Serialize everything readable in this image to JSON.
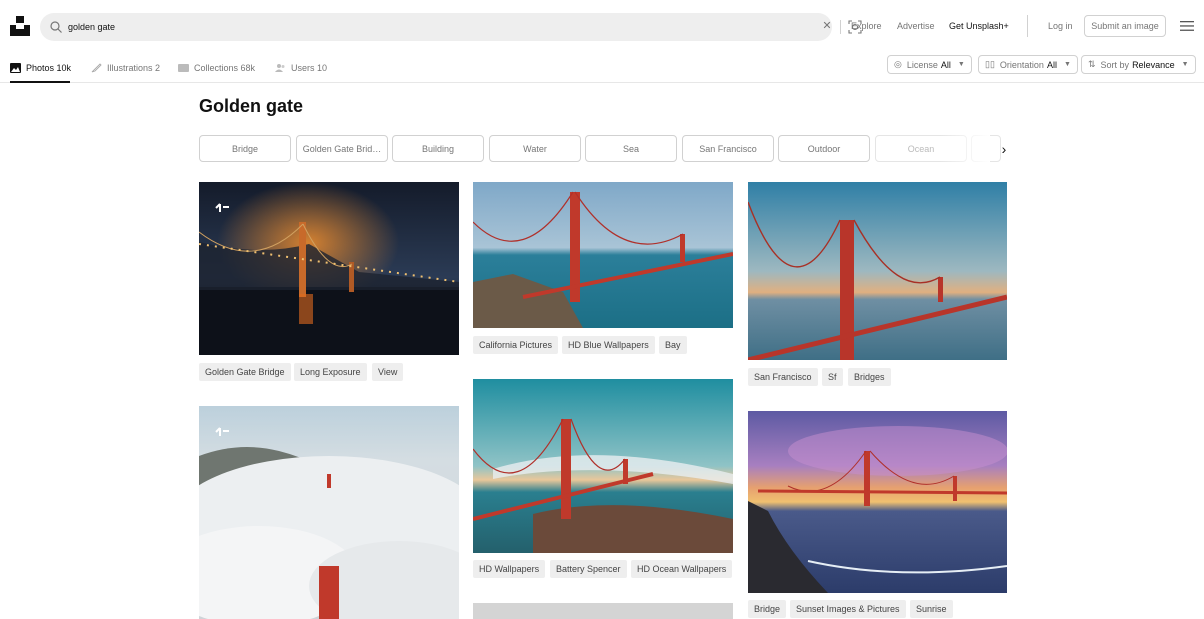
{
  "search": {
    "query": "golden gate",
    "icon": "search-icon"
  },
  "header": {
    "links": [
      "Explore",
      "Advertise"
    ],
    "get_plus": "Get Unsplash+",
    "login": "Log in",
    "submit": "Submit an image"
  },
  "tabs": [
    {
      "label": "Photos",
      "count": "10k",
      "icon": "photo-icon"
    },
    {
      "label": "Illustrations",
      "count": "2",
      "icon": "brush-icon"
    },
    {
      "label": "Collections",
      "count": "68k",
      "icon": "collections-icon"
    },
    {
      "label": "Users",
      "count": "10",
      "icon": "users-icon"
    }
  ],
  "filters": [
    {
      "label": "License",
      "value": "All",
      "icon": "license-icon"
    },
    {
      "label": "Orientation",
      "value": "All",
      "icon": "orientation-icon"
    },
    {
      "label": "Sort by",
      "value": "Relevance",
      "icon": "sort-icon"
    }
  ],
  "page_title": "Golden gate",
  "related_chips": [
    "Bridge",
    "Golden Gate Brid…",
    "Building",
    "Water",
    "Sea",
    "San Francisco",
    "Outdoor",
    "Ocean"
  ],
  "photo_tags": {
    "p1": [
      "Golden Gate Bridge",
      "Long Exposure",
      "View"
    ],
    "p2": [
      "California Pictures",
      "HD Blue Wallpapers",
      "Bay"
    ],
    "p3": [
      "San Francisco",
      "Sf",
      "Bridges"
    ],
    "p4": [
      "HD Wallpapers",
      "Battery Spencer",
      "HD Ocean Wallpapers"
    ],
    "p5": [
      "Bridge",
      "Sunset Images & Pictures",
      "Sunrise"
    ]
  },
  "colors": {
    "bridge_red": "#c0392b",
    "chip_border": "#d1d1d1",
    "tag_bg": "#eeeeee"
  }
}
